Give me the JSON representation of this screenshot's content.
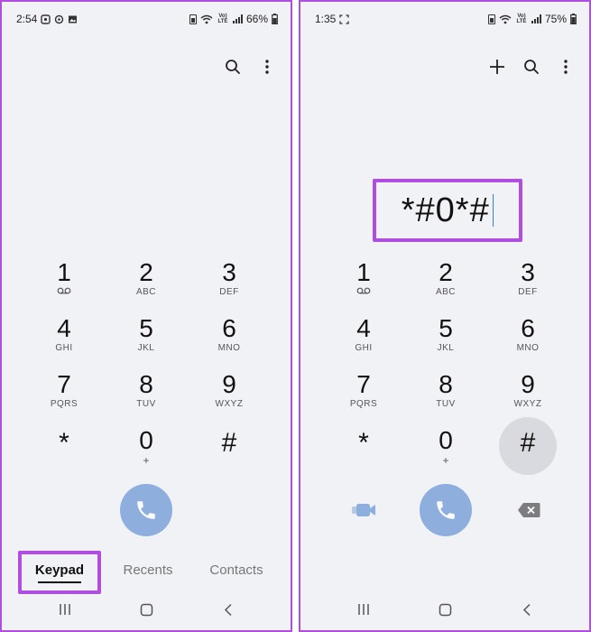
{
  "left": {
    "status": {
      "time": "2:54",
      "battery": "66%"
    },
    "keys": [
      {
        "digit": "1",
        "letters": ""
      },
      {
        "digit": "2",
        "letters": "ABC"
      },
      {
        "digit": "3",
        "letters": "DEF"
      },
      {
        "digit": "4",
        "letters": "GHI"
      },
      {
        "digit": "5",
        "letters": "JKL"
      },
      {
        "digit": "6",
        "letters": "MNO"
      },
      {
        "digit": "7",
        "letters": "PQRS"
      },
      {
        "digit": "8",
        "letters": "TUV"
      },
      {
        "digit": "9",
        "letters": "WXYZ"
      },
      {
        "digit": "*",
        "letters": ""
      },
      {
        "digit": "0",
        "letters": "+"
      },
      {
        "digit": "#",
        "letters": ""
      }
    ],
    "tabs": [
      "Keypad",
      "Recents",
      "Contacts"
    ],
    "active_tab": "Keypad"
  },
  "right": {
    "status": {
      "time": "1:35",
      "battery": "75%"
    },
    "dialed_number": "*#0*#",
    "keys": [
      {
        "digit": "1",
        "letters": ""
      },
      {
        "digit": "2",
        "letters": "ABC"
      },
      {
        "digit": "3",
        "letters": "DEF"
      },
      {
        "digit": "4",
        "letters": "GHI"
      },
      {
        "digit": "5",
        "letters": "JKL"
      },
      {
        "digit": "6",
        "letters": "MNO"
      },
      {
        "digit": "7",
        "letters": "PQRS"
      },
      {
        "digit": "8",
        "letters": "TUV"
      },
      {
        "digit": "9",
        "letters": "WXYZ"
      },
      {
        "digit": "*",
        "letters": ""
      },
      {
        "digit": "0",
        "letters": "+"
      },
      {
        "digit": "#",
        "letters": ""
      }
    ],
    "pressed_key": "#"
  },
  "colors": {
    "accent_highlight": "#b04ee0",
    "call_button": "#8eaede",
    "background": "#f1f2f6"
  },
  "icons": [
    "search-icon",
    "more-options-icon",
    "add-icon",
    "voicemail-icon",
    "phone-icon",
    "video-call-icon",
    "backspace-icon",
    "recents-nav-icon",
    "home-nav-icon",
    "back-nav-icon"
  ]
}
